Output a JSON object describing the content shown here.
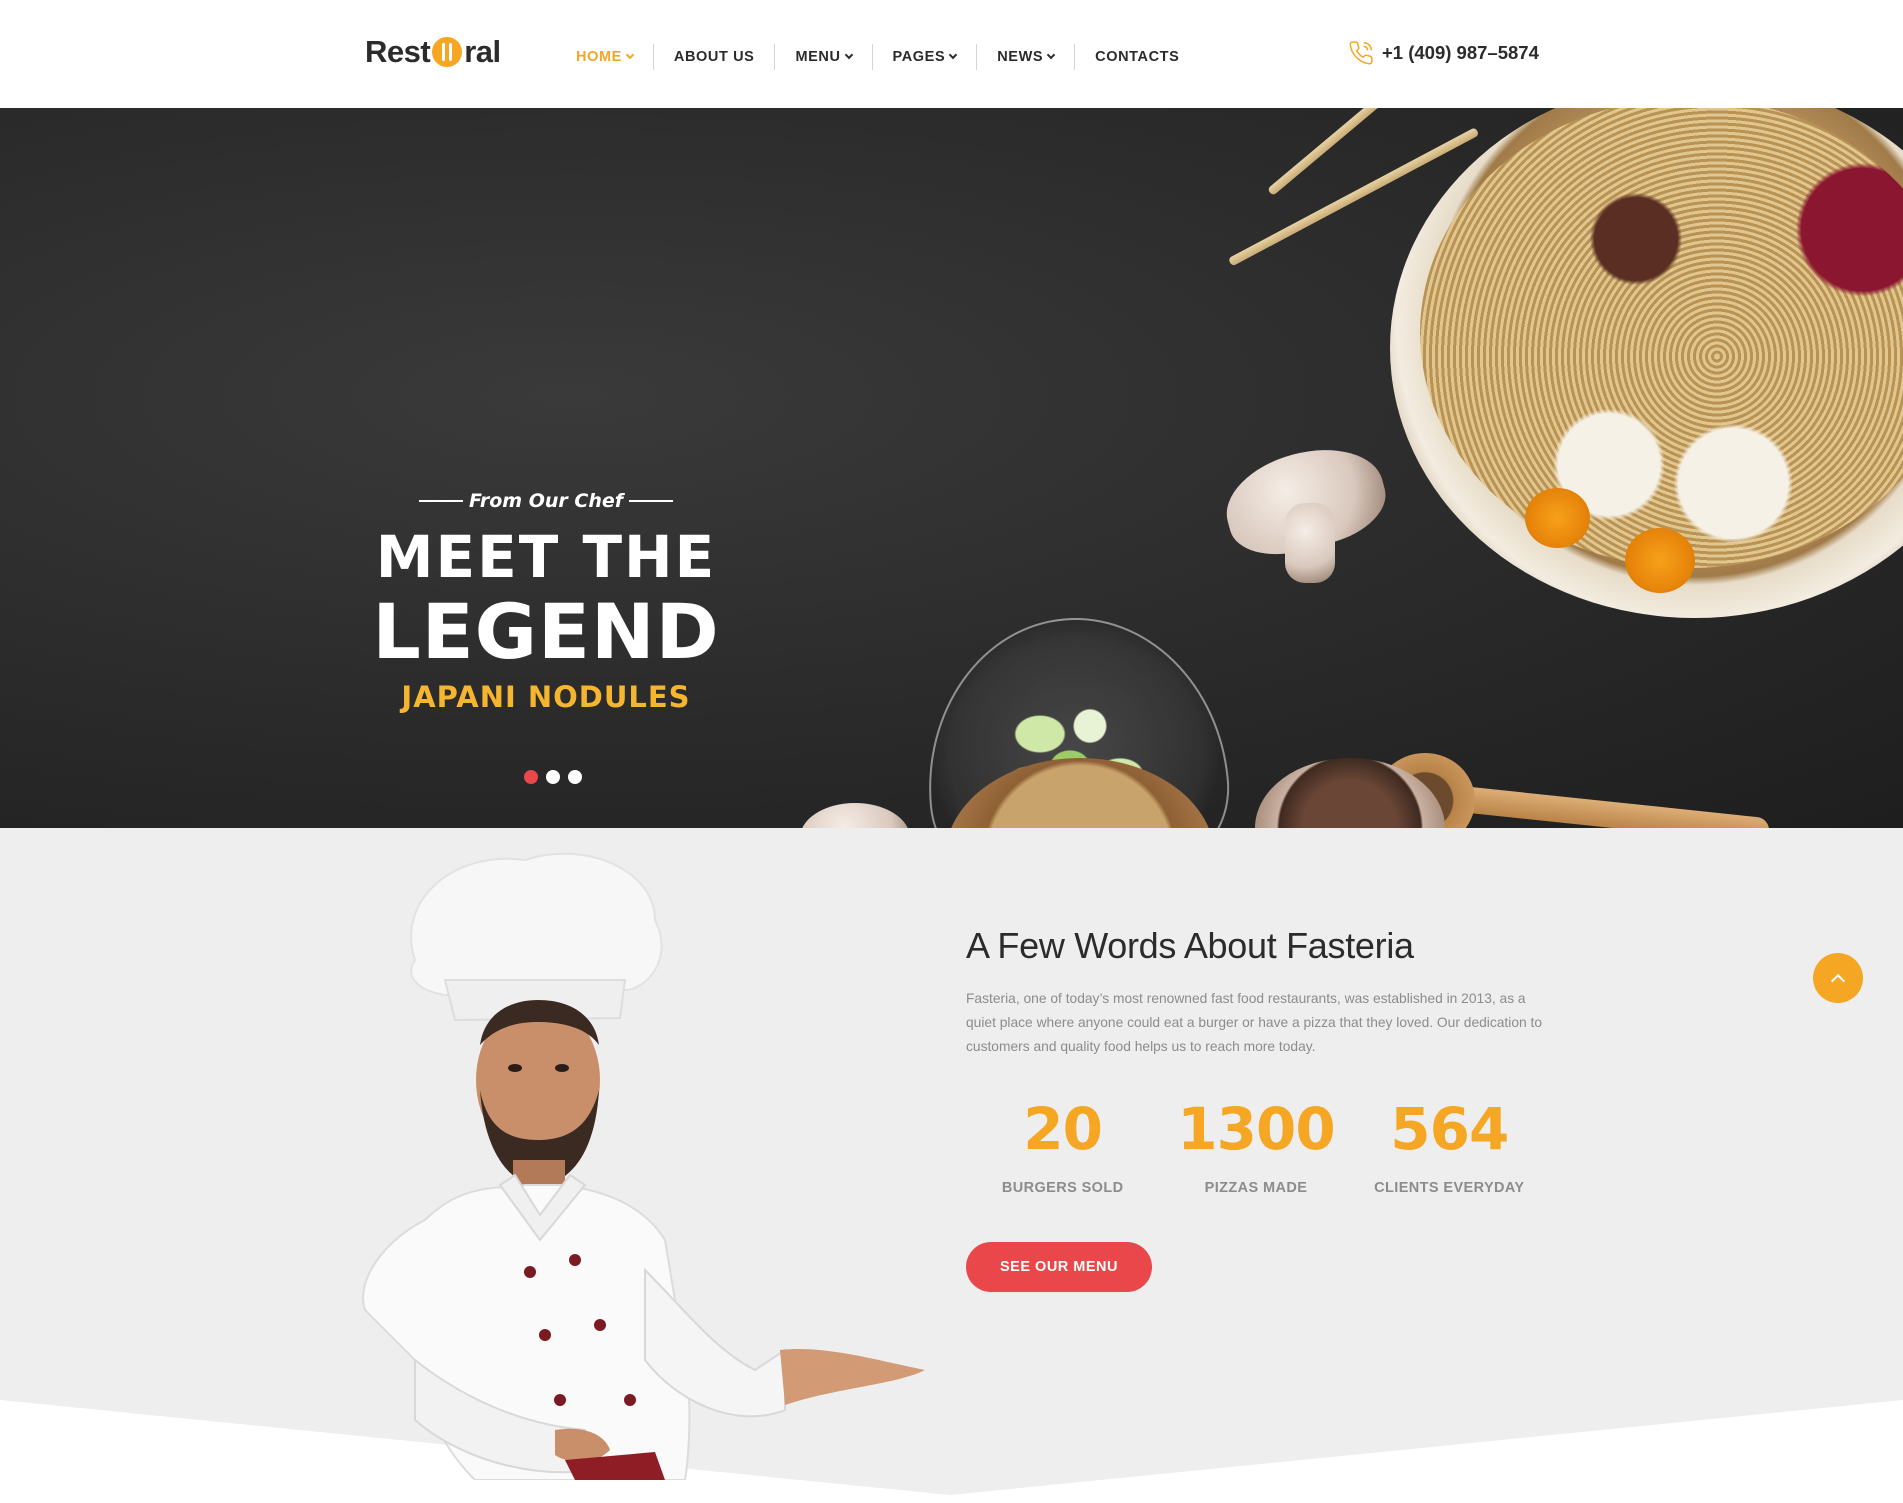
{
  "brand": {
    "logo_left": "Rest",
    "logo_right": "ral",
    "accent": "#f5a623",
    "red": "#e9474a"
  },
  "nav": {
    "items": [
      {
        "label": "HOME",
        "dropdown": true,
        "active": true
      },
      {
        "label": "ABOUT US",
        "dropdown": false,
        "active": false
      },
      {
        "label": "MENU",
        "dropdown": true,
        "active": false
      },
      {
        "label": "PAGES",
        "dropdown": true,
        "active": false
      },
      {
        "label": "NEWS",
        "dropdown": true,
        "active": false
      },
      {
        "label": "CONTACTS",
        "dropdown": false,
        "active": false
      }
    ]
  },
  "header": {
    "phone": "+1 (409) 987–5874",
    "phone_icon": "phone-icon"
  },
  "hero": {
    "eyebrow": "From Our Chef",
    "title_line1": "MEET THE",
    "title_line2": "LEGEND",
    "subtitle": "JAPANI NODULES",
    "slides_total": 3,
    "active_slide": 1
  },
  "about": {
    "title": "A Few Words About Fasteria",
    "text": "Fasteria, one of today’s most renowned fast food restaurants, was established in 2013, as a quiet place where anyone could eat a burger or have a pizza that they loved. Our dedication to customers and quality food helps us to reach more today.",
    "stats": [
      {
        "value": "20",
        "label": "BURGERS SOLD"
      },
      {
        "value": "1300",
        "label": "PIZZAS MADE"
      },
      {
        "value": "564",
        "label": "CLIENTS EVERYDAY"
      }
    ],
    "button_label": "SEE OUR MENU"
  },
  "scroll_top_icon": "chevron-up-icon"
}
